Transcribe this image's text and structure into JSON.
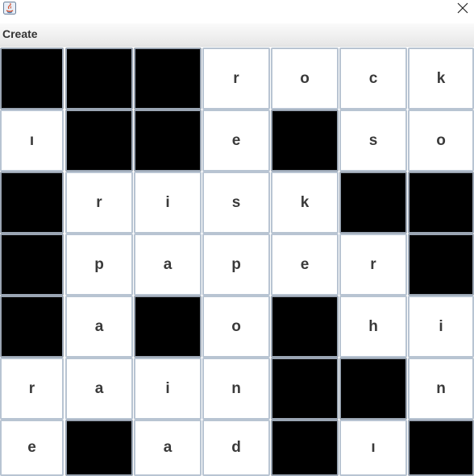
{
  "menu": {
    "items": [
      "Create"
    ]
  },
  "grid": {
    "rows": [
      [
        "#",
        "#",
        "#",
        "r",
        "o",
        "c",
        "k"
      ],
      [
        "ı",
        "#",
        "#",
        "e",
        "#",
        "s",
        "o"
      ],
      [
        "#",
        "r",
        "i",
        "s",
        "k",
        "#",
        "#"
      ],
      [
        "#",
        "p",
        "a",
        "p",
        "e",
        "r",
        "#"
      ],
      [
        "#",
        "a",
        "#",
        "o",
        "#",
        "h",
        "i"
      ],
      [
        "r",
        "a",
        "i",
        "n",
        "#",
        "#",
        "n"
      ],
      [
        "e",
        "#",
        "a",
        "d",
        "#",
        "ı",
        "#"
      ]
    ]
  }
}
